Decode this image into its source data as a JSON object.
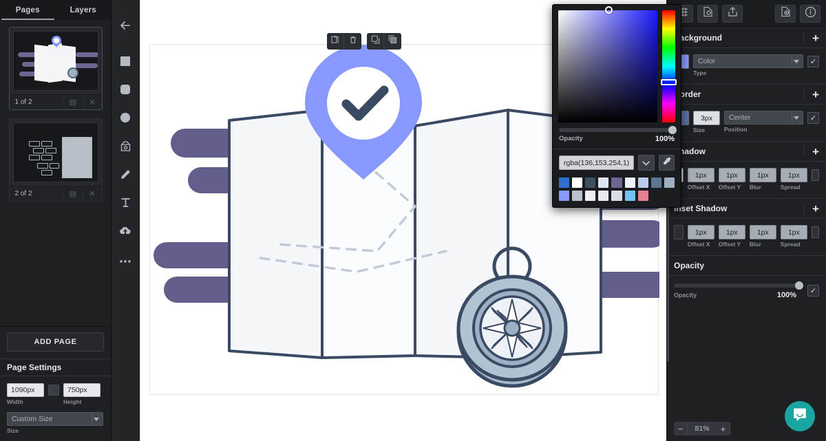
{
  "left_panel": {
    "tabs": [
      {
        "label": "Pages",
        "active": true
      },
      {
        "label": "Layers",
        "active": false
      }
    ],
    "pages": [
      {
        "label": "1 of 2",
        "selected": true,
        "duplicate_icon": "duplicate-icon",
        "close_icon": "close-icon"
      },
      {
        "label": "2 of 2",
        "selected": false,
        "duplicate_icon": "duplicate-icon",
        "close_icon": "close-icon"
      }
    ],
    "add_page_label": "ADD PAGE",
    "page_settings": {
      "title": "Page Settings",
      "width": {
        "value": "1090px",
        "label": "Width"
      },
      "height": {
        "value": "750px",
        "label": "Height"
      },
      "link_icon": "link-aspect-icon",
      "size": {
        "value": "Custom Size",
        "label": "Size"
      }
    }
  },
  "tool_rail": {
    "back_icon": "back-arrow-icon",
    "tools": [
      {
        "name": "rectangle-tool",
        "icon": "square-icon"
      },
      {
        "name": "rounded-rectangle-tool",
        "icon": "rounded-square-icon"
      },
      {
        "name": "ellipse-tool",
        "icon": "circle-icon"
      },
      {
        "name": "image-tool",
        "icon": "image-icon"
      },
      {
        "name": "pencil-tool",
        "icon": "pencil-icon"
      },
      {
        "name": "text-tool",
        "icon": "text-t-icon"
      },
      {
        "name": "upload-tool",
        "icon": "cloud-upload-icon"
      },
      {
        "name": "more-tools",
        "icon": "ellipsis-icon"
      }
    ]
  },
  "canvas": {
    "floating_toolbar": [
      {
        "name": "duplicate-object-button",
        "icon": "duplicate-icon"
      },
      {
        "name": "delete-object-button",
        "icon": "trash-icon"
      },
      {
        "name": "bring-forward-button",
        "icon": "bring-forward-icon"
      },
      {
        "name": "send-backward-button",
        "icon": "send-backward-icon"
      }
    ],
    "zoom": {
      "minus": "−",
      "value": "81%",
      "plus": "+"
    },
    "support_icon": "intercom-chat-icon"
  },
  "right_panel": {
    "toolbar": [
      {
        "name": "grid-settings-button",
        "icon": "grid-icon"
      },
      {
        "name": "document-settings-button",
        "icon": "file-gear-icon"
      },
      {
        "name": "export-button",
        "icon": "upload-share-icon"
      },
      {
        "name": "import-file-button",
        "icon": "file-add-icon"
      },
      {
        "name": "info-button",
        "icon": "info-circle-icon"
      }
    ],
    "sections": {
      "background": {
        "title": "Background",
        "add_icon": "plus-icon",
        "swatch_color": "#8899fe",
        "type": {
          "value": "Color",
          "label": "Type"
        },
        "enabled": true,
        "check_glyph": "✓"
      },
      "border": {
        "title": "Border",
        "add_icon": "plus-icon",
        "swatch_color": "#5a6fa8",
        "size": {
          "value": "3px",
          "label": "Size"
        },
        "position": {
          "value": "Center",
          "label": "Position"
        },
        "enabled": true,
        "check_glyph": "✓"
      },
      "shadow": {
        "title": "Shadow",
        "add_icon": "plus-icon",
        "swatch_color": "#cddbe8",
        "fields": [
          {
            "value": "1px",
            "label": "Offset X"
          },
          {
            "value": "1px",
            "label": "Offset Y"
          },
          {
            "value": "1px",
            "label": "Blur"
          },
          {
            "value": "1px",
            "label": "Spread"
          }
        ],
        "enabled": false
      },
      "inset_shadow": {
        "title": "Inset Shadow",
        "add_icon": "plus-icon",
        "swatch_color": "#2b2e33",
        "fields": [
          {
            "value": "1px",
            "label": "Offset X"
          },
          {
            "value": "1px",
            "label": "Offset Y"
          },
          {
            "value": "1px",
            "label": "Blur"
          },
          {
            "value": "1px",
            "label": "Spread"
          }
        ],
        "enabled": false
      },
      "opacity": {
        "title": "Opacity",
        "label": "Opacity",
        "value": "100%",
        "percent": 100,
        "enabled": true,
        "check_glyph": "✓"
      }
    }
  },
  "color_picker": {
    "opacity": {
      "label": "Opacity",
      "value": "100%",
      "percent": 100
    },
    "value": "rgba(136,153,254,1)",
    "dropdown_icon": "chevron-down-icon",
    "eyedropper_icon": "eyedropper-icon",
    "swatches_row1": [
      "#2f6fd0",
      "#ffffff",
      "#3f5064",
      "#dfe6f2",
      "#6b6793",
      "#eef3fb",
      "#b8cbe8",
      "#5a7793",
      "#9fb0c2"
    ],
    "swatches_row2": [
      "#8899fe",
      "#b9c2cc",
      "#eef0f2",
      "#e7eaee",
      "#d8dde6",
      "#72c2ef",
      "#e8808f"
    ]
  }
}
